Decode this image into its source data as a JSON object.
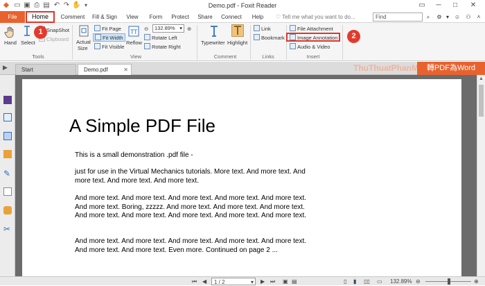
{
  "window": {
    "title": "Demo.pdf - Foxit Reader",
    "quick_access_icons": [
      "app-logo-icon",
      "open-icon",
      "save-icon",
      "print-icon",
      "undo-icon",
      "redo-icon",
      "hand-icon",
      "customize-icon"
    ]
  },
  "menu": {
    "tabs": [
      "File",
      "Home",
      "Comment",
      "Fill & Sign",
      "View",
      "Form",
      "Protect",
      "Share",
      "Connect",
      "Help"
    ],
    "tell_me_placeholder": "Tell me what you want to do...",
    "find_placeholder": "Find"
  },
  "ribbon": {
    "tools": {
      "hand": "Hand",
      "select": "Select",
      "snapshot": "SnapShot",
      "clipboard": "Clipboard",
      "label": "Tools"
    },
    "view": {
      "actual_size_line1": "Actual",
      "actual_size_line2": "Size",
      "fit_page": "Fit Page",
      "fit_width": "Fit Width",
      "fit_visible": "Fit Visible",
      "reflow": "Reflow",
      "zoom_value": "132.89%",
      "rotate_left": "Rotate Left",
      "rotate_right": "Rotate Right",
      "label": "View"
    },
    "comment": {
      "typewriter": "Typewriter",
      "highlight": "Highlight",
      "label": "Comment"
    },
    "links": {
      "link": "Link",
      "bookmark": "Bookmark",
      "label": "Links"
    },
    "insert": {
      "file_attachment": "File Attachment",
      "image_annotation": "Image Annotation",
      "audio_video": "Audio & Video",
      "label": "Insert"
    }
  },
  "annotations": {
    "step1": "1",
    "step2": "2"
  },
  "doc_tabs": [
    "Start",
    "Demo.pdf"
  ],
  "watermark": {
    "site": "ThuThuatPhanMem.vn",
    "banner": "轉PDF為Word"
  },
  "document": {
    "title": "A Simple PDF File",
    "paragraphs": [
      "This is a small demonstration .pdf file -",
      "just for use in the Virtual Mechanics tutorials. More text. And more text. And more text. And more text. And more text.",
      "And more text. And more text. And more text. And more text. And more text. And more text. Boring, zzzzz. And more text. And more text. And more text. And more text. And more text. And more text. And more text. And more text.",
      "And more text. And more text. And more text. And more text. And more text. And more text. And more text. Even more. Continued on page 2 ..."
    ]
  },
  "status": {
    "page_indicator": "1 / 2",
    "zoom": "132.89%"
  },
  "colors": {
    "accent": "#e8622e",
    "highlight_red": "#e0352b",
    "doc_bg": "#6b6b6b"
  }
}
